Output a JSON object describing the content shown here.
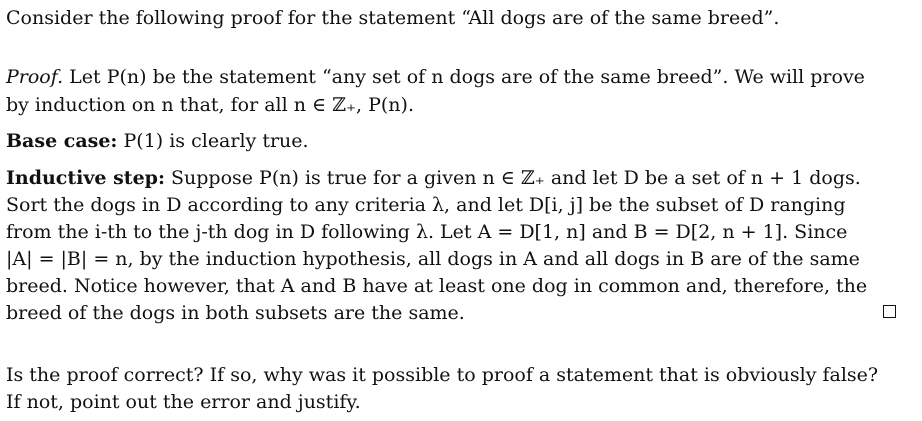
{
  "statement_intro": "Consider the following proof for the statement “All dogs are of the same breed”.",
  "proof": {
    "label": "Proof.",
    "text_1": " Let P(n) be the statement “any set of n dogs are of the same breed”. We will prove",
    "text_2": "by induction on n that, for all n ∈ ℤ₊, P(n)."
  },
  "base_case": {
    "label": "Base case:",
    "text": " P(1) is clearly true."
  },
  "inductive_step": {
    "label": "Inductive step:",
    "line_1": " Suppose P(n) is true for a given n ∈ ℤ₊ and let D be a set of n + 1 dogs.",
    "line_2": "Sort the dogs in D according to any criteria λ, and let D[i, j] be the subset of D ranging",
    "line_3": "from the i-th to the j-th dog in D following λ. Let A = D[1, n] and B = D[2, n + 1]. Since",
    "line_4": "|A| = |B| = n, by the induction hypothesis, all dogs in A and all dogs in B are of the same",
    "line_5": "breed. Notice however, that A and B have at least one dog in common and, therefore, the",
    "line_6": "breed of the dogs in both subsets are the same."
  },
  "question": {
    "line_1": "Is the proof correct? If so, why was it possible to proof a statement that is obviously false?",
    "line_2": "If not, point out the error and justify."
  }
}
